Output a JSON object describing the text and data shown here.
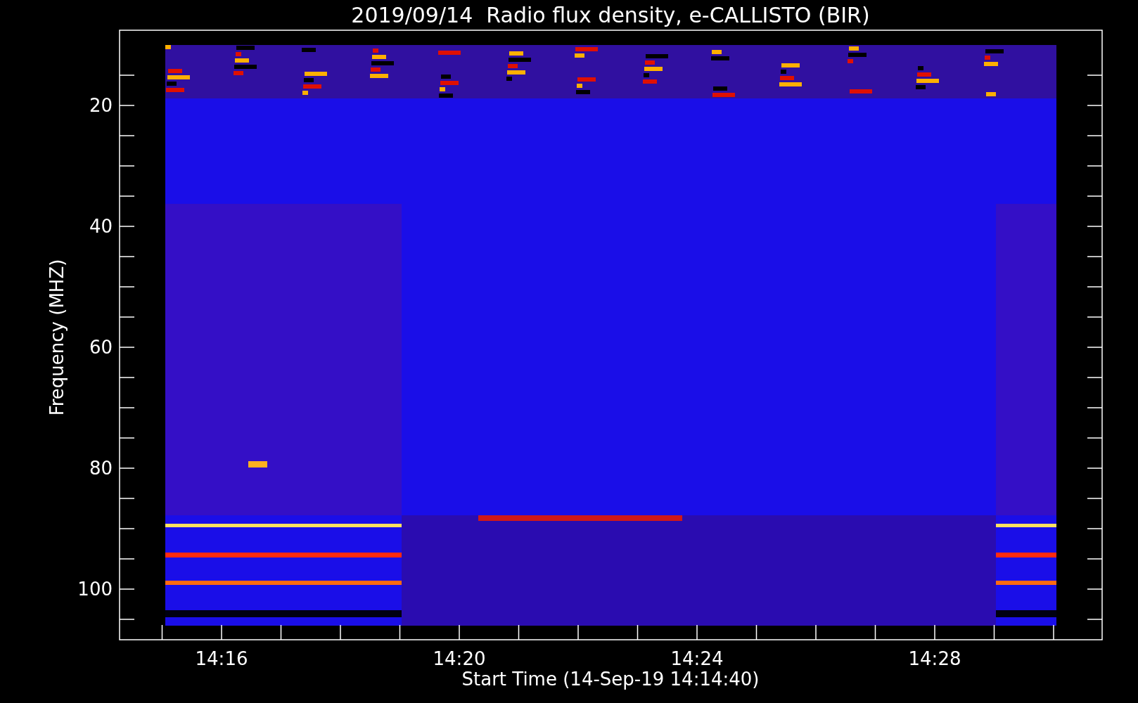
{
  "title": "2019/09/14  Radio flux density, e-CALLISTO (BIR)",
  "y_axis": {
    "label": "Frequency (MHZ)",
    "ticks": [
      "20",
      "40",
      "60",
      "80",
      "100"
    ]
  },
  "x_axis": {
    "label": "Start Time (14-Sep-19 14:14:40)",
    "ticks": [
      "14:16",
      "14:20",
      "14:24",
      "14:28"
    ]
  }
}
